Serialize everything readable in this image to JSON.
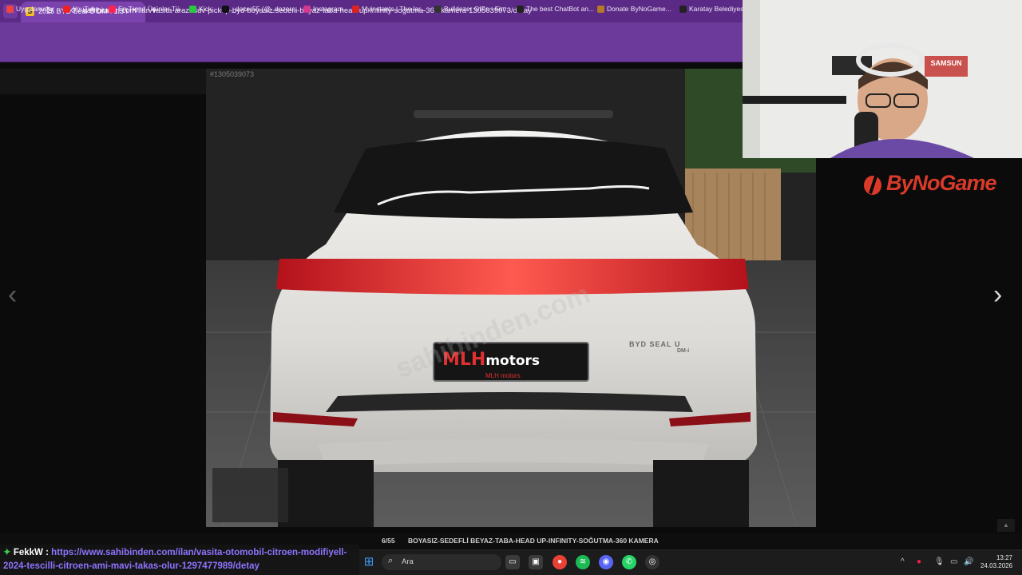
{
  "browser": {
    "tab_title": "2025 BYD Seal U DM-i 1.5 Phev",
    "tab_close": "×",
    "new_tab": "+",
    "address_domain": "sahibinden.com",
    "address_path": "/ilan/vasita-arazi-suv-pickup-byd-boyasiz-sedefli-beyaz-taba-head-up-infinity-sogutma-360-kamera-1305039073/detay",
    "bookmarks": [
      {
        "label": "Uygulamalar",
        "icon": "apps-grid-icon",
        "color": "#e44"
      },
      {
        "label": "YouTube",
        "icon": "youtube-icon",
        "color": "#e22"
      },
      {
        "label": "En Trend Ürünler Tü...",
        "icon": "trend-icon",
        "color": "#f25"
      },
      {
        "label": "Kick",
        "icon": "kick-icon",
        "color": "#28c840"
      },
      {
        "label": "_dozer55 (@_dozer...",
        "icon": "tiktok-icon",
        "color": "#111"
      },
      {
        "label": "Instagram",
        "icon": "instagram-icon",
        "color": "#d3398e"
      },
      {
        "label": "Myinstants | The lar...",
        "icon": "myinstants-icon",
        "color": "#d22"
      },
      {
        "label": "Bulldozer GIFs - Fin...",
        "icon": "gif-icon",
        "color": "#333"
      },
      {
        "label": "The best ChatBot an...",
        "icon": "chatbot-icon",
        "color": "#222"
      },
      {
        "label": "Donate ByNoGame...",
        "icon": "donate-icon",
        "color": "#b47a27"
      },
      {
        "label": "Karatay Belediyesi",
        "icon": "karatay-icon",
        "color": "#222"
      }
    ]
  },
  "listing": {
    "id_label": "#1305039073",
    "counter": "6/55",
    "caption": "BOYASIZ-SEDEFLİ BEYAZ-TABA-HEAD UP-INFINITY-SOĞUTMA-360 KAMERA",
    "plate_text": "MLH",
    "plate_text2": "motors",
    "plate_sub": "MLH motors",
    "badge_text": "BYD SEAL U",
    "badge_sub": "DM-i",
    "watermark": "sahibinden.com"
  },
  "overlay": {
    "brand": "ByNoGame",
    "webcam_sign": "SAMSUN"
  },
  "chat": {
    "user": "FekkW",
    "separator": ":",
    "message": "https://www.sahibinden.com/ilan/vasita-otomobil-citroen-modifiyell-2024-tescilli-citroen-ami-mavi-takas-olur-1297477989/detay"
  },
  "taskbar": {
    "search_placeholder": "Ara",
    "time": "13:27",
    "date": "24.03.2026"
  }
}
